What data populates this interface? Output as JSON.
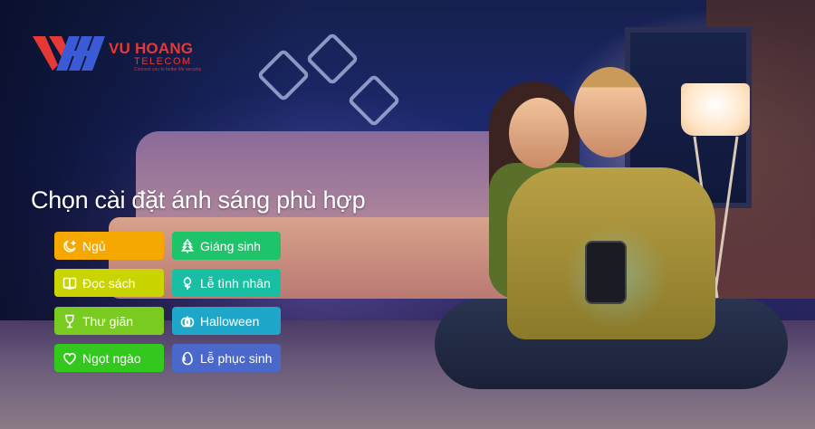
{
  "brand": {
    "name": "VU HOANG",
    "sub": "TELECOM",
    "tagline": "Connect you to better life security",
    "colors": {
      "primary": "#e53935"
    }
  },
  "headline": "Chọn cài đặt ánh sáng phù hợp",
  "modes": [
    {
      "label": "Ngủ",
      "icon": "moon-icon",
      "color": "#f5a800"
    },
    {
      "label": "Đọc sách",
      "icon": "book-icon",
      "color": "#c9d400"
    },
    {
      "label": "Thư giãn",
      "icon": "wineglass-icon",
      "color": "#7acb1f"
    },
    {
      "label": "Ngọt ngào",
      "icon": "heart-icon",
      "color": "#32c81e"
    },
    {
      "label": "Giáng sinh",
      "icon": "tree-icon",
      "color": "#1fc46a"
    },
    {
      "label": "Lễ tình nhân",
      "icon": "rose-icon",
      "color": "#19bfa2"
    },
    {
      "label": "Halloween",
      "icon": "pumpkin-icon",
      "color": "#1fa7c9"
    },
    {
      "label": "Lễ phục sinh",
      "icon": "egg-icon",
      "color": "#4a68c9"
    }
  ]
}
